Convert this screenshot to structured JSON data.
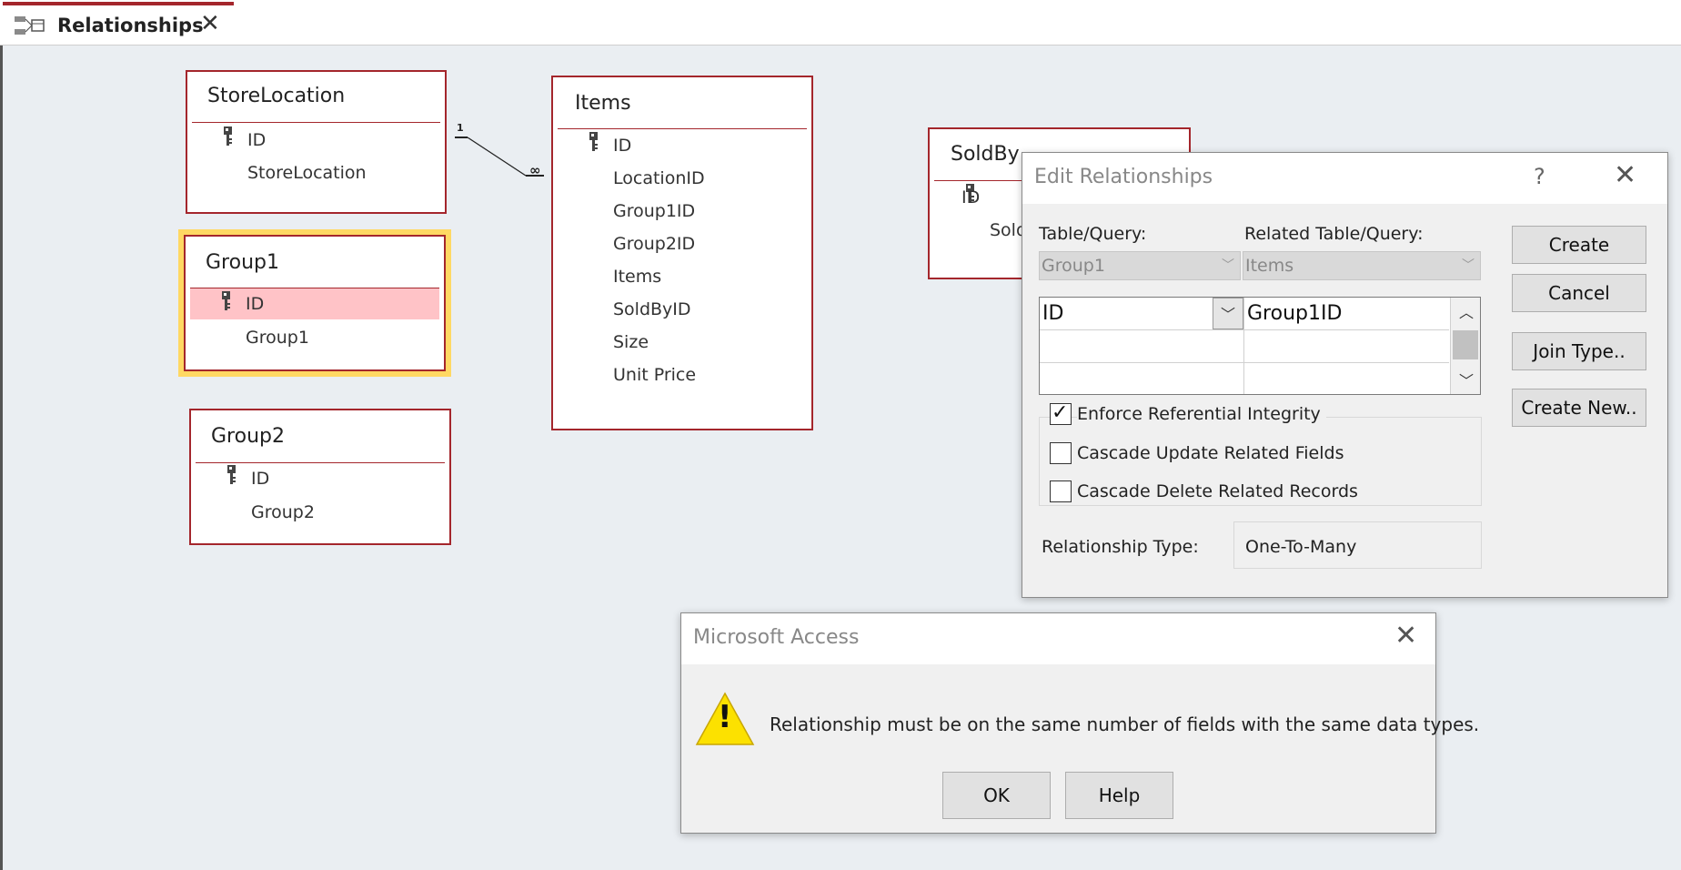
{
  "tab": {
    "title": "Relationships"
  },
  "tables": {
    "storelocation": {
      "title": "StoreLocation",
      "fields": [
        "ID",
        "StoreLocation"
      ]
    },
    "group1": {
      "title": "Group1",
      "fields": [
        "ID",
        "Group1"
      ]
    },
    "group2": {
      "title": "Group2",
      "fields": [
        "ID",
        "Group2"
      ]
    },
    "items": {
      "title": "Items",
      "fields": [
        "ID",
        "LocationID",
        "Group1ID",
        "Group2ID",
        "Items",
        "SoldByID",
        "Size",
        "Unit Price"
      ]
    },
    "soldby": {
      "title": "SoldBy",
      "fields": [
        "ID",
        "Sold"
      ]
    }
  },
  "relation_markers": {
    "one": "1",
    "many": "∞"
  },
  "edit_dialog": {
    "title": "Edit Relationships",
    "help": "?",
    "table_query_label": "Table/Query:",
    "related_label": "Related Table/Query:",
    "table_value": "Group1",
    "related_value": "Items",
    "left_field": "ID",
    "right_field": "Group1ID",
    "enforce_label": "Enforce Referential Integrity",
    "cascade_update_label": "Cascade Update Related Fields",
    "cascade_delete_label": "Cascade Delete Related Records",
    "enforce_checked": true,
    "cascade_update_checked": false,
    "cascade_delete_checked": false,
    "relationship_type_label": "Relationship Type:",
    "relationship_type_value": "One-To-Many",
    "buttons": {
      "create": "Create",
      "cancel": "Cancel",
      "join_type": "Join Type..",
      "create_new": "Create New.."
    }
  },
  "alert": {
    "title": "Microsoft Access",
    "message": "Relationship must be on the same number of fields with the same data types.",
    "icon_glyph": "!",
    "ok": "OK",
    "help": "Help"
  },
  "colors": {
    "table_border": "#a4262c",
    "selection": "#ffd863",
    "highlight_row": "#ffc3c7",
    "workspace": "#eaeef2"
  }
}
